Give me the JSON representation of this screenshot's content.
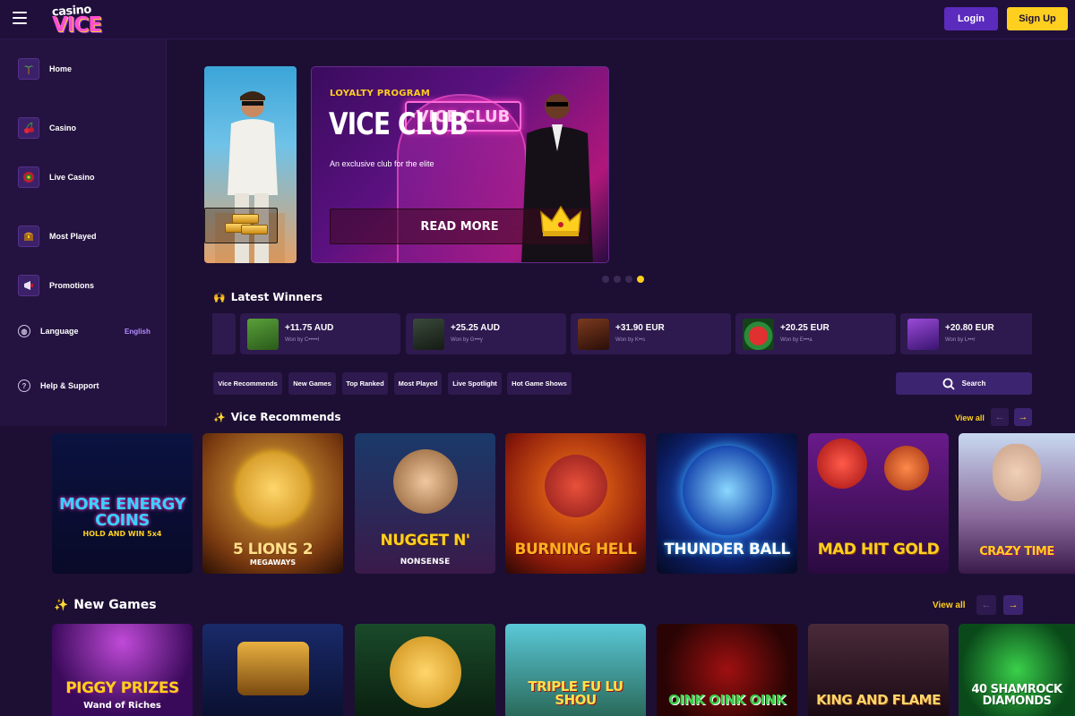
{
  "header": {
    "logo_top": "casino",
    "logo_bottom": "VICE",
    "login_label": "Login",
    "signup_label": "Sign Up"
  },
  "sidebar": {
    "items": [
      {
        "label": "Home",
        "icon": "palm-tree-icon"
      },
      {
        "label": "Casino",
        "icon": "cherry-icon"
      },
      {
        "label": "Live Casino",
        "icon": "roulette-icon"
      },
      {
        "label": "Most Played",
        "icon": "chest-icon"
      },
      {
        "label": "Promotions",
        "icon": "megaphone-icon"
      }
    ],
    "language_label": "Language",
    "language_value": "English",
    "help_label": "Help & Support"
  },
  "hero": {
    "eyebrow": "LOYALTY PROGRAM",
    "title": "VICE CLUB",
    "neon_sign": "VICE CLUB",
    "subtitle": "An exclusive club for the elite",
    "cta": "READ MORE",
    "slides": 4,
    "active_slide": 4
  },
  "winners": {
    "title": "Latest Winners",
    "items": [
      {
        "amount": "+11.75 AUD",
        "by": "Won by C•••••l",
        "thumb": "#3f7a2a"
      },
      {
        "amount": "+25.25 AUD",
        "by": "Won by G•••y",
        "thumb": "#2a3a2a"
      },
      {
        "amount": "+31.90 EUR",
        "by": "Won by K••s",
        "thumb": "#4a1e14"
      },
      {
        "amount": "+20.25 EUR",
        "by": "Won by E•••a",
        "thumb": "#1e6a3a"
      },
      {
        "amount": "+20.80 EUR",
        "by": "Won by L•••r",
        "thumb": "#6a2aa0"
      }
    ]
  },
  "tabs": [
    "Vice Recommends",
    "New Games",
    "Top Ranked",
    "Most Played",
    "Live Spotlight",
    "Hot Game Shows"
  ],
  "search_label": "Search",
  "sections": {
    "recommends": {
      "title": "Vice Recommends",
      "view_all": "View all",
      "games": [
        {
          "name": "MORE ENERGY COINS",
          "sub": "HOLD AND WIN 5x4"
        },
        {
          "name": "5 LIONS 2",
          "sub": "MEGAWAYS"
        },
        {
          "name": "NUGGET N'",
          "sub": "NONSENSE"
        },
        {
          "name": "BURNING HELL",
          "sub": ""
        },
        {
          "name": "THUNDER BALL",
          "sub": ""
        },
        {
          "name": "MAD HIT GOLD",
          "sub": ""
        },
        {
          "name": "CRAZY TIME",
          "sub": ""
        }
      ]
    },
    "new_games": {
      "title": "New Games",
      "view_all": "View all",
      "games": [
        {
          "name": "PIGGY PRIZES",
          "sub": "Wand of Riches"
        },
        {
          "name": "",
          "sub": ""
        },
        {
          "name": "",
          "sub": ""
        },
        {
          "name": "TRIPLE FU LU SHOU",
          "sub": ""
        },
        {
          "name": "OINK OINK OINK",
          "sub": ""
        },
        {
          "name": "KING AND FLAME",
          "sub": ""
        },
        {
          "name": "40 SHAMROCK DIAMONDS",
          "sub": ""
        }
      ]
    }
  },
  "colors": {
    "accent": "#ffcf1f",
    "primary": "#5b2bbd",
    "background": "#1c0f33",
    "panel": "#2e1a4f"
  }
}
